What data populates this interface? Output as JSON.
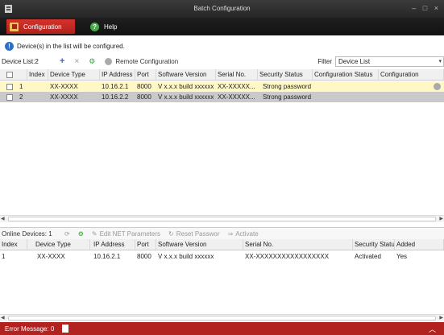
{
  "window": {
    "title": "Batch Configuration",
    "controls": "– □ ×"
  },
  "tabs": [
    {
      "label": "Configuration",
      "icon": "config-icon"
    },
    {
      "label": "Help",
      "icon": "help-icon"
    }
  ],
  "info": {
    "text": "Device(s) in the list will be configured."
  },
  "toolbar": {
    "device_list_label": "Device List:2",
    "add_icon": "+",
    "delete_icon": "×",
    "remote_config_label": "Remote Configuration",
    "filter_label": "Filter",
    "filter_value": "Device List"
  },
  "device_table": {
    "headers": [
      "Index",
      "Device Type",
      "IP Address",
      "Port",
      "Software Version",
      "Serial No.",
      "Security Status",
      "Configuration Status",
      "Configuration"
    ],
    "rows": [
      [
        "1",
        "XX-XXXX",
        "10.16.2.1",
        "8000",
        "V x.x.x build xxxxxx",
        "XX-XXXXX...",
        "Strong password",
        "",
        ""
      ],
      [
        "2",
        "XX-XXXX",
        "10.16.2.2",
        "8000",
        "V x.x.x build xxxxxx",
        "XX-XXXXX...",
        "Strong password",
        "",
        ""
      ]
    ]
  },
  "online_bar": {
    "label": "Online Devices: 1",
    "edit_label": "Edit NET Parameters",
    "reset_label": "Reset Passwor",
    "activate_label": "Activate"
  },
  "online_table": {
    "headers": [
      "Index",
      "Device Type",
      "IP Address",
      "Port",
      "Software Version",
      "Serial No.",
      "Security Status",
      "Added"
    ],
    "rows": [
      [
        "1",
        "XX-XXXX",
        "10.16.2.1",
        "8000",
        "V x.x.x build xxxxxx",
        "XX-XXXXXXXXXXXXXXXXX",
        "Activated",
        "Yes"
      ]
    ]
  },
  "status": {
    "error_label": "Error Message: 0"
  },
  "colors": {
    "accent_red": "#b22320",
    "tab_active": "#c62a24",
    "row_selected": "#fff8c4"
  }
}
